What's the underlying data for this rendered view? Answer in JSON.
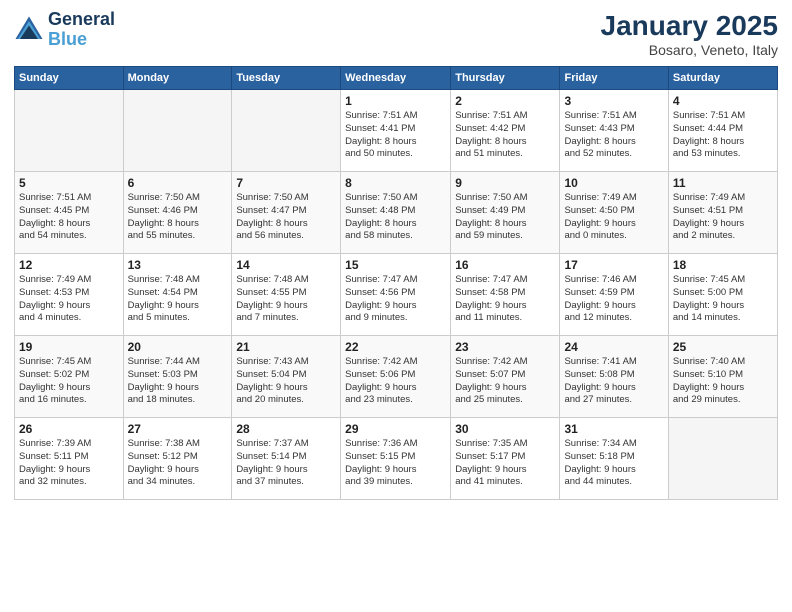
{
  "header": {
    "logo_line1": "General",
    "logo_line2": "Blue",
    "month": "January 2025",
    "location": "Bosaro, Veneto, Italy"
  },
  "weekdays": [
    "Sunday",
    "Monday",
    "Tuesday",
    "Wednesday",
    "Thursday",
    "Friday",
    "Saturday"
  ],
  "weeks": [
    [
      {
        "day": "",
        "info": ""
      },
      {
        "day": "",
        "info": ""
      },
      {
        "day": "",
        "info": ""
      },
      {
        "day": "1",
        "info": "Sunrise: 7:51 AM\nSunset: 4:41 PM\nDaylight: 8 hours\nand 50 minutes."
      },
      {
        "day": "2",
        "info": "Sunrise: 7:51 AM\nSunset: 4:42 PM\nDaylight: 8 hours\nand 51 minutes."
      },
      {
        "day": "3",
        "info": "Sunrise: 7:51 AM\nSunset: 4:43 PM\nDaylight: 8 hours\nand 52 minutes."
      },
      {
        "day": "4",
        "info": "Sunrise: 7:51 AM\nSunset: 4:44 PM\nDaylight: 8 hours\nand 53 minutes."
      }
    ],
    [
      {
        "day": "5",
        "info": "Sunrise: 7:51 AM\nSunset: 4:45 PM\nDaylight: 8 hours\nand 54 minutes."
      },
      {
        "day": "6",
        "info": "Sunrise: 7:50 AM\nSunset: 4:46 PM\nDaylight: 8 hours\nand 55 minutes."
      },
      {
        "day": "7",
        "info": "Sunrise: 7:50 AM\nSunset: 4:47 PM\nDaylight: 8 hours\nand 56 minutes."
      },
      {
        "day": "8",
        "info": "Sunrise: 7:50 AM\nSunset: 4:48 PM\nDaylight: 8 hours\nand 58 minutes."
      },
      {
        "day": "9",
        "info": "Sunrise: 7:50 AM\nSunset: 4:49 PM\nDaylight: 8 hours\nand 59 minutes."
      },
      {
        "day": "10",
        "info": "Sunrise: 7:49 AM\nSunset: 4:50 PM\nDaylight: 9 hours\nand 0 minutes."
      },
      {
        "day": "11",
        "info": "Sunrise: 7:49 AM\nSunset: 4:51 PM\nDaylight: 9 hours\nand 2 minutes."
      }
    ],
    [
      {
        "day": "12",
        "info": "Sunrise: 7:49 AM\nSunset: 4:53 PM\nDaylight: 9 hours\nand 4 minutes."
      },
      {
        "day": "13",
        "info": "Sunrise: 7:48 AM\nSunset: 4:54 PM\nDaylight: 9 hours\nand 5 minutes."
      },
      {
        "day": "14",
        "info": "Sunrise: 7:48 AM\nSunset: 4:55 PM\nDaylight: 9 hours\nand 7 minutes."
      },
      {
        "day": "15",
        "info": "Sunrise: 7:47 AM\nSunset: 4:56 PM\nDaylight: 9 hours\nand 9 minutes."
      },
      {
        "day": "16",
        "info": "Sunrise: 7:47 AM\nSunset: 4:58 PM\nDaylight: 9 hours\nand 11 minutes."
      },
      {
        "day": "17",
        "info": "Sunrise: 7:46 AM\nSunset: 4:59 PM\nDaylight: 9 hours\nand 12 minutes."
      },
      {
        "day": "18",
        "info": "Sunrise: 7:45 AM\nSunset: 5:00 PM\nDaylight: 9 hours\nand 14 minutes."
      }
    ],
    [
      {
        "day": "19",
        "info": "Sunrise: 7:45 AM\nSunset: 5:02 PM\nDaylight: 9 hours\nand 16 minutes."
      },
      {
        "day": "20",
        "info": "Sunrise: 7:44 AM\nSunset: 5:03 PM\nDaylight: 9 hours\nand 18 minutes."
      },
      {
        "day": "21",
        "info": "Sunrise: 7:43 AM\nSunset: 5:04 PM\nDaylight: 9 hours\nand 20 minutes."
      },
      {
        "day": "22",
        "info": "Sunrise: 7:42 AM\nSunset: 5:06 PM\nDaylight: 9 hours\nand 23 minutes."
      },
      {
        "day": "23",
        "info": "Sunrise: 7:42 AM\nSunset: 5:07 PM\nDaylight: 9 hours\nand 25 minutes."
      },
      {
        "day": "24",
        "info": "Sunrise: 7:41 AM\nSunset: 5:08 PM\nDaylight: 9 hours\nand 27 minutes."
      },
      {
        "day": "25",
        "info": "Sunrise: 7:40 AM\nSunset: 5:10 PM\nDaylight: 9 hours\nand 29 minutes."
      }
    ],
    [
      {
        "day": "26",
        "info": "Sunrise: 7:39 AM\nSunset: 5:11 PM\nDaylight: 9 hours\nand 32 minutes."
      },
      {
        "day": "27",
        "info": "Sunrise: 7:38 AM\nSunset: 5:12 PM\nDaylight: 9 hours\nand 34 minutes."
      },
      {
        "day": "28",
        "info": "Sunrise: 7:37 AM\nSunset: 5:14 PM\nDaylight: 9 hours\nand 37 minutes."
      },
      {
        "day": "29",
        "info": "Sunrise: 7:36 AM\nSunset: 5:15 PM\nDaylight: 9 hours\nand 39 minutes."
      },
      {
        "day": "30",
        "info": "Sunrise: 7:35 AM\nSunset: 5:17 PM\nDaylight: 9 hours\nand 41 minutes."
      },
      {
        "day": "31",
        "info": "Sunrise: 7:34 AM\nSunset: 5:18 PM\nDaylight: 9 hours\nand 44 minutes."
      },
      {
        "day": "",
        "info": ""
      }
    ]
  ]
}
